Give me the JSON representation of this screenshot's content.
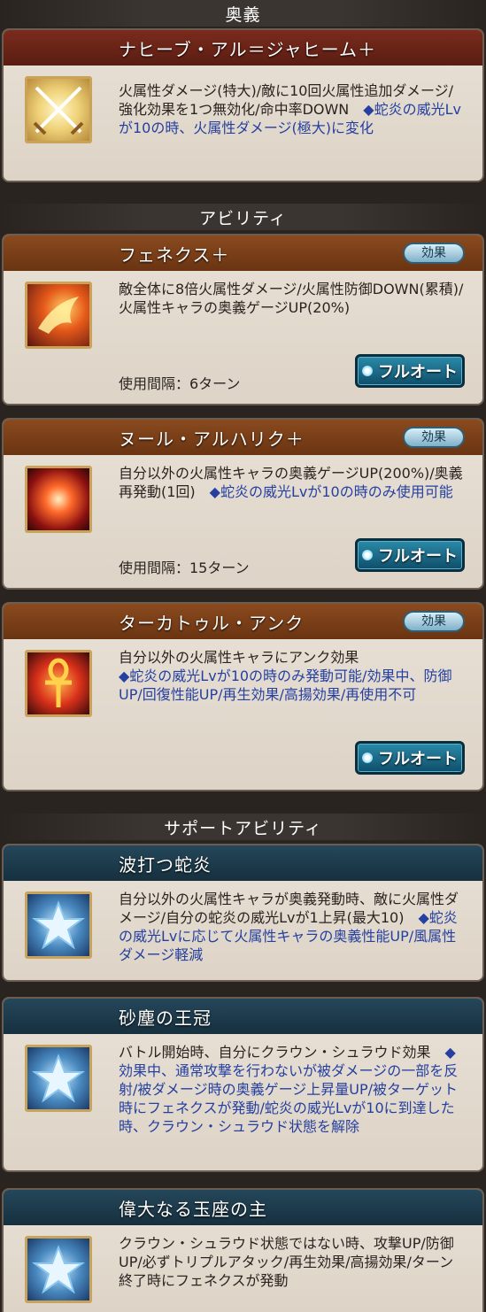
{
  "sections": {
    "ougi": "奥義",
    "ability": "アビリティ",
    "support": "サポートアビリティ"
  },
  "ougi_card": {
    "name": "ナヒーブ・アル＝ジャヒーム＋",
    "desc_main": "火属性ダメージ(特大)/敵に10回火属性追加ダメージ/強化効果を1つ無効化/命中率DOWN　",
    "desc_note": "◆蛇炎の威光Lvが10の時、火属性ダメージ(極大)に変化",
    "icon": "crossed-swords-icon"
  },
  "abilities": [
    {
      "name": "フェネクス＋",
      "effect_label": "効果",
      "desc_main": "敵全体に8倍火属性ダメージ/火属性防御DOWN(累積)/火属性キャラの奥義ゲージUP(20%)",
      "desc_note": "",
      "cooldown": "使用間隔：6ターン",
      "auto_label": "フルオート",
      "icon": "phoenix-icon"
    },
    {
      "name": "ヌール・アルハリク＋",
      "effect_label": "効果",
      "desc_main": "自分以外の火属性キャラの奥義ゲージUP(200%)/奥義再発動(1回)　",
      "desc_note": "◆蛇炎の威光Lvが10の時のみ使用可能",
      "cooldown": "使用間隔：15ターン",
      "auto_label": "フルオート",
      "icon": "fire-orb-icon"
    },
    {
      "name": "ターカトゥル・アンク",
      "effect_label": "効果",
      "desc_main": "自分以外の火属性キャラにアンク効果",
      "desc_note": "◆蛇炎の威光Lvが10の時のみ発動可能/効果中、防御UP/回復性能UP/再生効果/高揚効果/再使用不可",
      "cooldown": "",
      "auto_label": "フルオート",
      "icon": "ankh-icon"
    }
  ],
  "supports": [
    {
      "name": "波打つ蛇炎",
      "desc_main": "自分以外の火属性キャラが奥義発動時、敵に火属性ダメージ/自分の蛇炎の威光Lvが1上昇(最大10)　",
      "desc_note": "◆蛇炎の威光Lvに応じて火属性キャラの奥義性能UP/風属性ダメージ軽減",
      "icon": "star-icon"
    },
    {
      "name": "砂塵の王冠",
      "desc_main": "バトル開始時、自分にクラウン・シュラウド効果　",
      "desc_note": "◆効果中、通常攻撃を行わないが被ダメージの一部を反射/被ダメージ時の奥義ゲージ上昇量UP/被ターゲット時にフェネクスが発動/蛇炎の威光Lvが10に到達した時、クラウン・シュラウド状態を解除",
      "icon": "star-icon"
    },
    {
      "name": "偉大なる玉座の主",
      "desc_main": "クラウン・シュラウド状態ではない時、攻撃UP/防御UP/必ずトリプルアタック/再生効果/高揚効果/ターン終了時にフェネクスが発動",
      "desc_note": "",
      "icon": "star-icon"
    }
  ]
}
